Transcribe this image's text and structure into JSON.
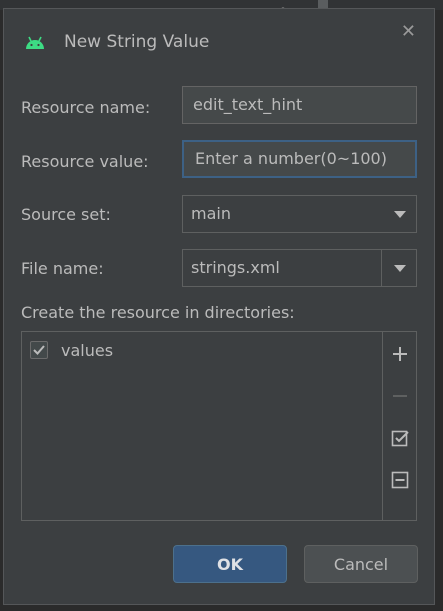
{
  "dialog": {
    "title": "New String Value",
    "title_icon": "android-icon",
    "close_icon": "close-icon"
  },
  "form": {
    "resource_name_label": "Resource name:",
    "resource_name_value": "edit_text_hint",
    "resource_value_label": "Resource value:",
    "resource_value_value": "Enter a number(0~100)",
    "source_set_label": "Source set:",
    "source_set_value": "main",
    "file_name_label": "File name:",
    "file_name_value": "strings.xml",
    "directories_label": "Create the resource in directories:"
  },
  "directories": {
    "items": [
      {
        "label": "values",
        "checked": true
      }
    ],
    "toolbar": [
      "add-icon",
      "remove-icon",
      "select-all-icon",
      "unselect-all-icon"
    ]
  },
  "buttons": {
    "ok_label": "OK",
    "cancel_label": "Cancel"
  },
  "colors": {
    "dialog_bg": "#3c3f41",
    "accent_blue": "#365880",
    "focus_border": "#3d6185",
    "android_green": "#3ddc84"
  }
}
